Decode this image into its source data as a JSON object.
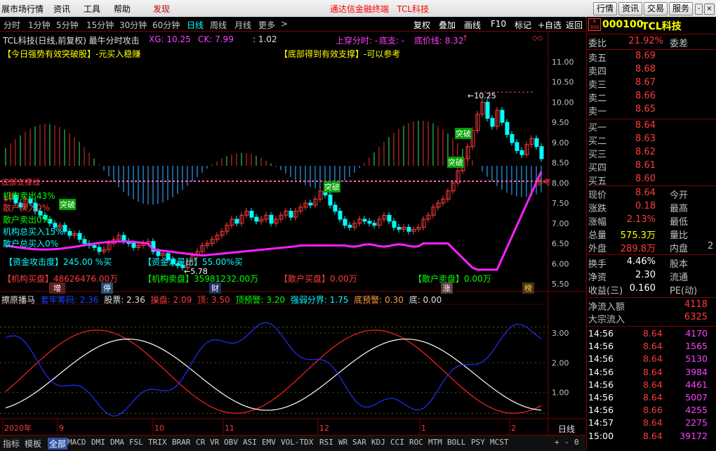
{
  "menu": {
    "items": [
      "展市场行情",
      "资讯",
      "工具",
      "帮助"
    ],
    "discover": "发现",
    "center_title": "通达信金融终端",
    "center_stock": "TCL科技",
    "right_buttons": [
      "行情",
      "资讯",
      "交易",
      "服务"
    ],
    "window_buttons": [
      "-",
      "□",
      "×"
    ]
  },
  "toolbar": {
    "periods": [
      "分时",
      "1分钟",
      "5分钟",
      "15分钟",
      "30分钟",
      "60分钟",
      "日线",
      "周线",
      "月线",
      "更多"
    ],
    "active": "日线",
    "more_arrow": ">",
    "actions": [
      "复权",
      "叠加",
      "画线",
      "F10",
      "标记",
      "+自选",
      "返回"
    ]
  },
  "header": {
    "left": "TCL科技(日线,前复权) 最牛分时攻击",
    "xg": "XG: 10.25",
    "ck": "CK: 7.99",
    "ratio": ": 1.02",
    "cross": "上穿分时: -",
    "bottom": "底支: -",
    "bottom_price": "底价线: 8.32",
    "note1": "【今日强势有效突破股】-元买入稳赚",
    "note2": "【底部得到有效支撑】-可以参考"
  },
  "quote": {
    "badge_top": "R",
    "badge_bottom": "300",
    "code": "000100",
    "name": "TCL科技",
    "weibi_label": "委比",
    "weibi": "21.92%",
    "weicha_label": "委差",
    "asks": [
      {
        "label": "卖五",
        "price": "8.69"
      },
      {
        "label": "卖四",
        "price": "8.68"
      },
      {
        "label": "卖三",
        "price": "8.67"
      },
      {
        "label": "卖二",
        "price": "8.66"
      },
      {
        "label": "卖一",
        "price": "8.65"
      }
    ],
    "bids": [
      {
        "label": "买一",
        "price": "8.64"
      },
      {
        "label": "买二",
        "price": "8.63"
      },
      {
        "label": "买三",
        "price": "8.62"
      },
      {
        "label": "买四",
        "price": "8.61"
      },
      {
        "label": "买五",
        "price": "8.60"
      }
    ],
    "stats": [
      {
        "label": "现价",
        "value": "8.64",
        "color": "red",
        "label2": "今开",
        "value2": ""
      },
      {
        "label": "涨跌",
        "value": "0.18",
        "color": "red",
        "label2": "最高",
        "value2": ""
      },
      {
        "label": "涨幅",
        "value": "2.13%",
        "color": "red",
        "label2": "最低",
        "value2": ""
      },
      {
        "label": "总量",
        "value": "575.3万",
        "color": "yellow",
        "label2": "量比",
        "value2": ""
      },
      {
        "label": "外盘",
        "value": "289.8万",
        "color": "red",
        "label2": "内盘",
        "value2": "2"
      }
    ],
    "stats2": [
      {
        "label": "换手",
        "value": "4.46%",
        "color": "white",
        "label2": "股本"
      },
      {
        "label": "净资",
        "value": "2.30",
        "color": "white",
        "label2": "流通"
      },
      {
        "label": "收益(三)",
        "value": "0.160",
        "color": "white",
        "label2": "PE(动)"
      }
    ],
    "flow": [
      {
        "label": "净流入额",
        "value": "4118"
      },
      {
        "label": "大宗流入",
        "value": "6325"
      }
    ],
    "ticks": [
      {
        "time": "14:56",
        "price": "8.64",
        "vol": "4170"
      },
      {
        "time": "14:56",
        "price": "8.64",
        "vol": "1565"
      },
      {
        "time": "14:56",
        "price": "8.64",
        "vol": "5130"
      },
      {
        "time": "14:56",
        "price": "8.64",
        "vol": "3984"
      },
      {
        "time": "14:56",
        "price": "8.64",
        "vol": "4461"
      },
      {
        "time": "14:56",
        "price": "8.64",
        "vol": "5007"
      },
      {
        "time": "14:56",
        "price": "8.66",
        "vol": "4255"
      },
      {
        "time": "14:57",
        "price": "8.64",
        "vol": "2275"
      },
      {
        "time": "15:00",
        "price": "8.64",
        "vol": "39172"
      }
    ]
  },
  "main_chart": {
    "y_ticks": [
      "11.00",
      "10.50",
      "10.00",
      "9.50",
      "9.00",
      "8.50",
      "8.00",
      "7.50",
      "7.00",
      "6.50",
      "6.00",
      "5.50"
    ],
    "high_label": "10.25",
    "low_label": "5.78",
    "bottom_price_tag": "参考",
    "left_tag": "底部支撑线",
    "breakout1": "突破",
    "breakout2": "突破",
    "breakout3": "突破",
    "breakout4": "突破",
    "lines": [
      {
        "text": "机构卖出43%",
        "color": "#00ff00"
      },
      {
        "text": "散户买入0%",
        "color": "#ff3b3b"
      },
      {
        "text": "散户卖出0%",
        "color": "#00ff00"
      },
      {
        "text": "机构总买入15%",
        "color": "#00ffff"
      },
      {
        "text": "散户总买入0%",
        "color": "#00ffff"
      }
    ],
    "fund_in": "【资金攻击度】245.00 %买",
    "fund_flow": "【资金流量比】55.00%买",
    "inst_buy": "【机构买盘】48626476.00万",
    "inst_sell": "【机构卖盘】35981232.00万",
    "retail_buy": "【散户买盘】0.00万",
    "retail_sell": "【散户卖盘】0.00万",
    "markers": [
      "增",
      "停",
      "财",
      "涨",
      "榜"
    ]
  },
  "sub_chart": {
    "name": "擦原播马",
    "line_a": "套牢筹码: 2.36",
    "line_b": "股票: 2.36",
    "line_c": "操盘: 2.09",
    "line_d": "顶: 3.50",
    "line_e": "顶预警: 3.20",
    "line_f": "强弱分界: 1.75",
    "line_g": "底预警: 0.30",
    "line_h": "底: 0.00",
    "y_ticks": [
      "3.00",
      "2.00",
      "1.00"
    ]
  },
  "x_axis": {
    "labels": [
      "2020年",
      "9",
      "10",
      "11",
      "12",
      "1",
      "2"
    ],
    "period": "日线"
  },
  "tabs": {
    "lead": [
      "指标",
      "模板",
      "全部"
    ],
    "items": [
      "MACD",
      "DMI",
      "DMA",
      "FSL",
      "TRIX",
      "BRAR",
      "CR",
      "VR",
      "OBV",
      "ASI",
      "EMV",
      "VOL-TDX",
      "RSI",
      "WR",
      "SAR",
      "KDJ",
      "CCI",
      "ROC",
      "MTM",
      "BOLL",
      "PSY",
      "MCST"
    ],
    "active": "全部",
    "right": [
      "+",
      "-",
      "0"
    ]
  },
  "colors": {
    "up": "#ff3b3b",
    "down": "#00ffff",
    "ma": "#ff20ff",
    "panel_border": "#800000"
  }
}
